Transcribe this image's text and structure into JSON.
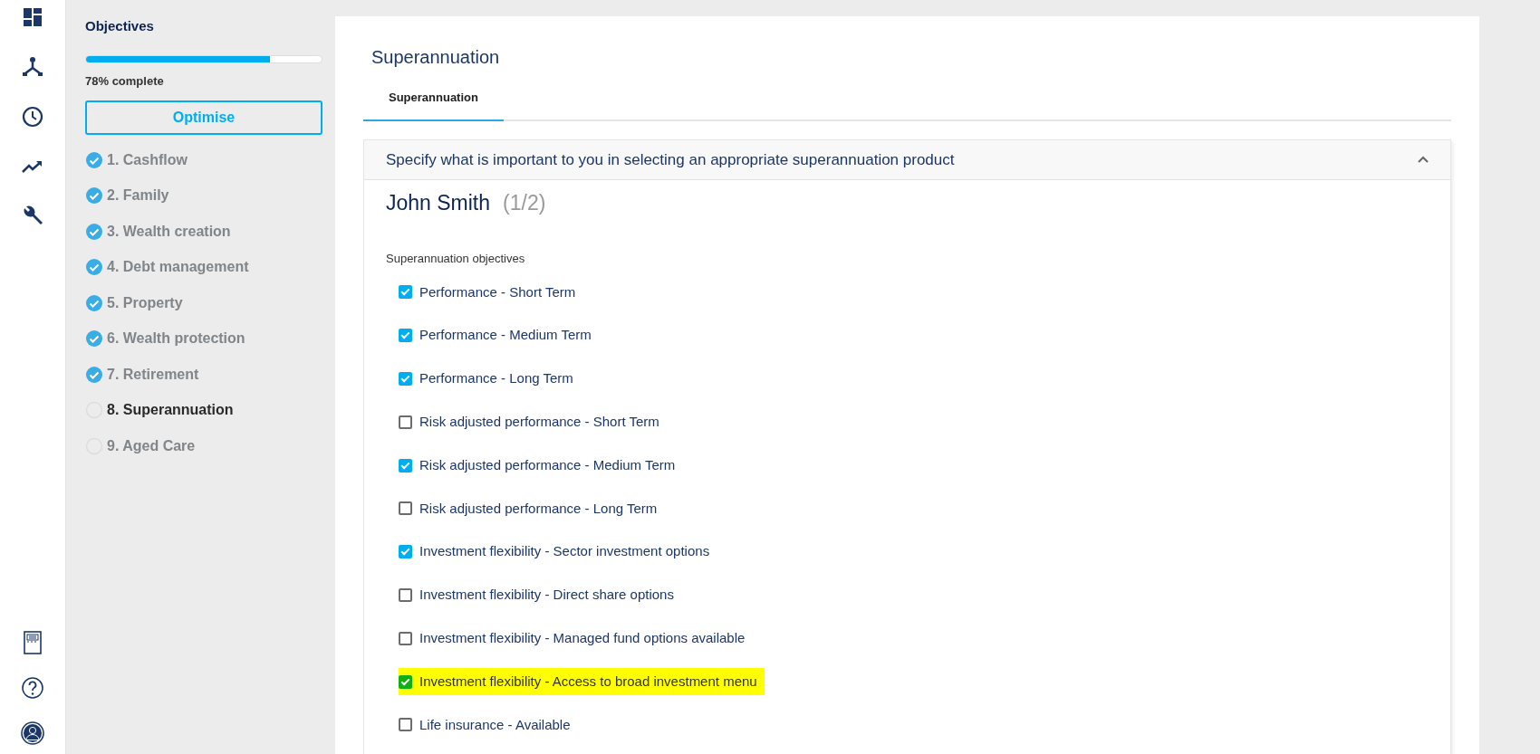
{
  "sidebar": {
    "title": "Objectives",
    "progress": {
      "level": 0.78,
      "label": "78% complete"
    },
    "button": "Optimise",
    "steps": [
      {
        "label": "1. Cashflow",
        "done": true,
        "selected": false
      },
      {
        "label": "2. Family",
        "done": true,
        "selected": false
      },
      {
        "label": "3. Wealth creation",
        "done": true,
        "selected": false
      },
      {
        "label": "4. Debt management",
        "done": true,
        "selected": false
      },
      {
        "label": "5. Property",
        "done": true,
        "selected": false
      },
      {
        "label": "6. Wealth protection",
        "done": true,
        "selected": false
      },
      {
        "label": "7. Retirement",
        "done": true,
        "selected": false
      },
      {
        "label": "8. Superannuation",
        "done": false,
        "selected": true
      },
      {
        "label": "9. Aged Care",
        "done": false,
        "selected": false
      }
    ]
  },
  "main": {
    "title": "Superannuation",
    "tabs": [
      {
        "label": "Superannuation",
        "selected": true
      }
    ],
    "panel": {
      "header": "Specify what is important to you in selecting an appropriate superannuation product",
      "expanded": true,
      "person": "John Smith",
      "person_count": "(1/2)",
      "group_label": "Superannuation objectives",
      "options": [
        {
          "label": "Performance - Short Term",
          "checked": true,
          "highlighted": false
        },
        {
          "label": "Performance - Medium Term",
          "checked": true,
          "highlighted": false
        },
        {
          "label": "Performance - Long Term",
          "checked": true,
          "highlighted": false
        },
        {
          "label": "Risk adjusted performance - Short Term",
          "checked": false,
          "highlighted": false
        },
        {
          "label": "Risk adjusted performance - Medium Term",
          "checked": true,
          "highlighted": false
        },
        {
          "label": "Risk adjusted performance - Long Term",
          "checked": false,
          "highlighted": false
        },
        {
          "label": "Investment flexibility - Sector investment options",
          "checked": true,
          "highlighted": false
        },
        {
          "label": "Investment flexibility - Direct share options",
          "checked": false,
          "highlighted": false
        },
        {
          "label": "Investment flexibility - Managed fund options available",
          "checked": false,
          "highlighted": false
        },
        {
          "label": "Investment flexibility - Access to broad investment menu",
          "checked": true,
          "highlighted": true
        },
        {
          "label": "Life insurance - Available",
          "checked": false,
          "highlighted": false
        }
      ]
    }
  }
}
